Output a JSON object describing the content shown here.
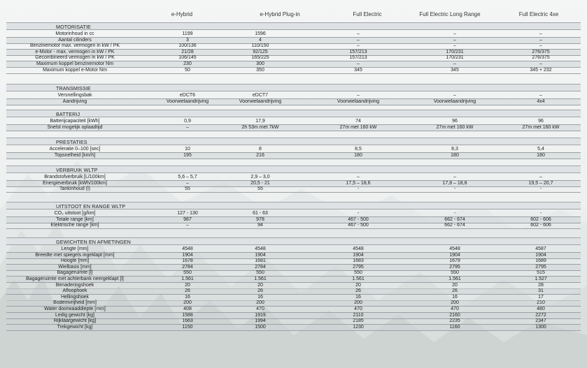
{
  "columns": [
    "e-Hybrid",
    "e-Hybrid Plug-in",
    "Full Electric",
    "Full Electric Long Range",
    "Full Electric 4xe"
  ],
  "sections": [
    {
      "title": "MOTORISATIE",
      "rows": [
        {
          "label": "Motorinhoud in cc",
          "values": [
            "1199",
            "1596",
            "–",
            "–",
            "–"
          ]
        },
        {
          "label": "Aantal cilinders",
          "values": [
            "3",
            "4",
            "–",
            "–",
            "–"
          ]
        },
        {
          "label": "Benzinemotor max. vermogen in kW / PK",
          "values": [
            "100/136",
            "110/150",
            "–",
            "–",
            "–"
          ]
        },
        {
          "label": "e-Motor - max. vermogen in kW / PK",
          "values": [
            "21/28",
            "92/125",
            "157/213",
            "170/231",
            "276/375"
          ]
        },
        {
          "label": "Gecombineerd vermogen in kW / PK",
          "values": [
            "106/145",
            "165/225",
            "157/213",
            "170/231",
            "276/375"
          ]
        },
        {
          "label": "Maximum koppel benzinemotor Nm",
          "values": [
            "230",
            "300",
            "–",
            "–",
            "–"
          ]
        },
        {
          "label": "Maximum koppel e-Motor Nm",
          "values": [
            "50",
            "350",
            "345",
            "345",
            "345 + 232"
          ]
        }
      ]
    },
    {
      "title": "TRANSMISSIE",
      "rows": [
        {
          "label": "Versnellingsbak",
          "values": [
            "eDCT6",
            "eDCT7",
            "–",
            "–",
            "–"
          ]
        },
        {
          "label": "Aandrijving",
          "values": [
            "Voorwielaandrijving",
            "Voorwielaandrijving",
            "Voorwielaandrijving",
            "Voorwielaandrijving",
            "4x4"
          ]
        }
      ]
    },
    {
      "title": "BATTERIJ",
      "rows": [
        {
          "label": "Batterijcapaciteit [kWh]",
          "values": [
            "0,9",
            "17,9",
            "74",
            "96",
            "96"
          ]
        },
        {
          "label": "Snelst mogelijk oplaadtijd",
          "values": [
            "–",
            "2h 53m met 7kW",
            "27m met 160 kW",
            "27m met 160 kW",
            "27m met 160 kW"
          ]
        }
      ]
    },
    {
      "title": "PRESTATIES",
      "rows": [
        {
          "label": "Acceleratie 0–100 [sec]",
          "values": [
            "10",
            "8",
            "8,5",
            "8,3",
            "5,4"
          ]
        },
        {
          "label": "Topsnelheid [km/h]",
          "values": [
            "195",
            "216",
            "180",
            "180",
            "180"
          ]
        }
      ]
    },
    {
      "title": "VERBRUIK WLTP",
      "rows": [
        {
          "label": "Brandstofverbruik [L/100km]",
          "values": [
            "5,6 – 5,7",
            "2,9 – 3,0",
            "–",
            "–",
            "–"
          ]
        },
        {
          "label": "Energieverbruik [kWh/100km]",
          "values": [
            "–",
            "20,5 - 21",
            "17,5 – 18,6",
            "17,8 – 18,8",
            "19,5 – 20,7"
          ]
        },
        {
          "label": "Tankinhoud (l)",
          "values": [
            "55",
            "55",
            "-",
            "-",
            "-"
          ]
        }
      ]
    },
    {
      "title": "UITSTOOT EN RANGE WLTP",
      "rows": [
        {
          "label": "CO₂ uitstoot [g/km]",
          "values": [
            "127 - 130",
            "61 - 63",
            "-",
            "-",
            "-"
          ]
        },
        {
          "label": "Totale range [km]",
          "values": [
            "987",
            "978",
            "467 - 500",
            "662 - 674",
            "602 - 606"
          ]
        },
        {
          "label": "Elektrische range [km]",
          "values": [
            "–",
            "94",
            "467 - 500",
            "662 - 674",
            "602 - 606"
          ]
        }
      ]
    },
    {
      "title": "GEWICHTEN EN AFMETINGEN",
      "rows": [
        {
          "label": "Lengte [mm]",
          "values": [
            "4548",
            "4548",
            "4548",
            "4548",
            "4587"
          ]
        },
        {
          "label": "Breedte met spiegels ingeklapt [mm]",
          "values": [
            "1904",
            "1904",
            "1904",
            "1904",
            "1904"
          ]
        },
        {
          "label": "Hoogte [mm]",
          "values": [
            "1678",
            "1681",
            "1683",
            "1679",
            "1689"
          ]
        },
        {
          "label": "Wielbasis [mm]",
          "values": [
            "2784",
            "2784",
            "2795",
            "2795",
            "2795"
          ]
        },
        {
          "label": "Bagageruimte [l]",
          "values": [
            "550",
            "550",
            "550",
            "550",
            "515"
          ]
        },
        {
          "label": "Bagageruimte met achterbank neergeklapt [l]",
          "values": [
            "1.561",
            "1.561",
            "1.561",
            "1.561",
            "1.527"
          ]
        },
        {
          "label": "Benaderingshoek",
          "values": [
            "20",
            "20",
            "20",
            "20",
            "28"
          ]
        },
        {
          "label": "Afloophoek",
          "values": [
            "26",
            "26",
            "26",
            "26",
            "31"
          ]
        },
        {
          "label": "Hellingshoek",
          "values": [
            "16",
            "16",
            "16",
            "16",
            "17"
          ]
        },
        {
          "label": "Bodemvrijheid [mm]",
          "values": [
            "200",
            "200",
            "200",
            "200",
            "210"
          ]
        },
        {
          "label": "Water doorwaaddiepte [mm]",
          "values": [
            "408",
            "470",
            "470",
            "470",
            "480"
          ]
        },
        {
          "label": "Ledig gewicht [kg]",
          "values": [
            "1588",
            "1919",
            "2110",
            "2160",
            "2272"
          ]
        },
        {
          "label": "Rijklaargewicht [kg]",
          "values": [
            "1663",
            "1994",
            "2185",
            "2235",
            "2347"
          ]
        },
        {
          "label": "Trekgewicht [kg]",
          "values": [
            "1150",
            "1500",
            "1230",
            "1160",
            "1300"
          ]
        }
      ]
    }
  ]
}
